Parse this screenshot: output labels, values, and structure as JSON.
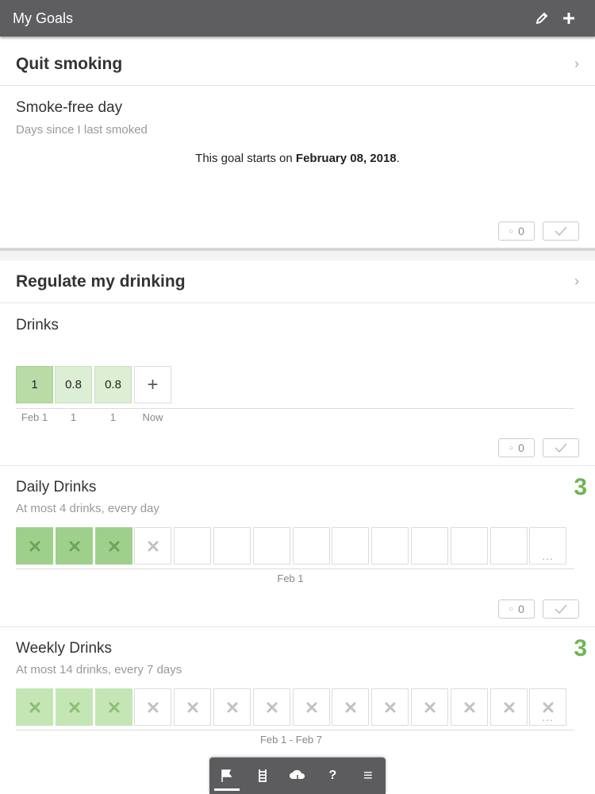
{
  "header": {
    "title": "My Goals"
  },
  "quit_smoking": {
    "title": "Quit smoking",
    "goal_name": "Smoke-free day",
    "goal_sub": "Days since I last smoked",
    "start_prefix": "This goal starts on ",
    "start_date": "February 08, 2018",
    "start_suffix": ".",
    "tag_count": "0"
  },
  "regulate_drinking": {
    "title": "Regulate my drinking",
    "drinks": {
      "name": "Drinks",
      "values": [
        "1",
        "0.8",
        "0.8"
      ],
      "labels": [
        "Feb 1",
        "1",
        "1",
        "Now"
      ],
      "add_symbol": "+",
      "tag_count": "0"
    },
    "daily": {
      "name": "Daily Drinks",
      "sub": "At most 4 drinks, every day",
      "count": "3",
      "axis_label": "Feb 1",
      "more": "...",
      "tag_count": "0"
    },
    "weekly": {
      "name": "Weekly Drinks",
      "sub": "At most 14 drinks, every 7 days",
      "count": "3",
      "axis_label": "Feb 1 - Feb 7",
      "more": "..."
    }
  },
  "bottom_nav": {
    "items": [
      "flag-icon",
      "ladder-icon",
      "cloud-icon",
      "?",
      "≡"
    ]
  }
}
